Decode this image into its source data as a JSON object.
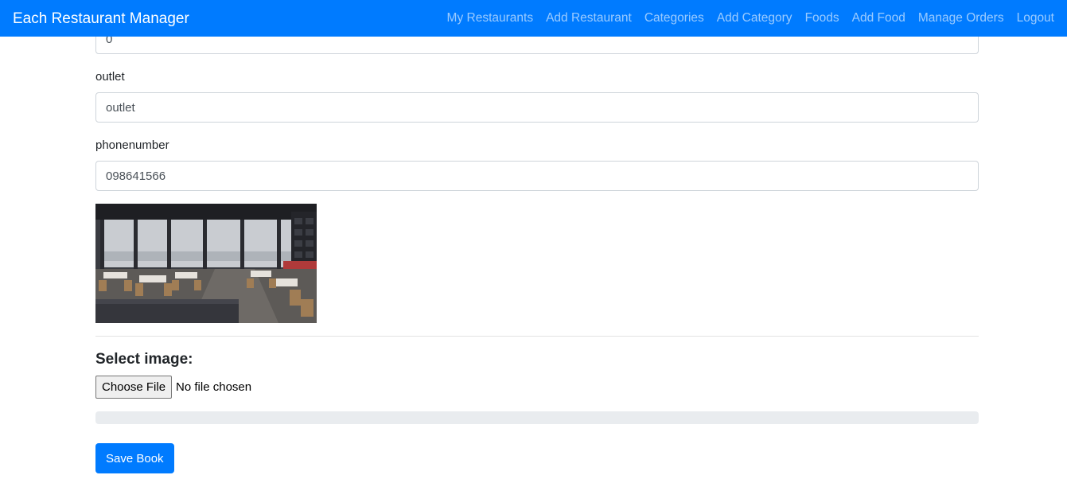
{
  "navbar": {
    "brand": "Each Restaurant Manager",
    "links": [
      {
        "label": "My Restaurants"
      },
      {
        "label": "Add Restaurant"
      },
      {
        "label": "Categories"
      },
      {
        "label": "Add Category"
      },
      {
        "label": "Foods"
      },
      {
        "label": "Add Food"
      },
      {
        "label": "Manage Orders"
      },
      {
        "label": "Logout"
      }
    ]
  },
  "form": {
    "top_field_value": "0",
    "outlet": {
      "label": "outlet",
      "value": "outlet"
    },
    "phonenumber": {
      "label": "phonenumber",
      "value": "098641566"
    },
    "select_image_title": "Select image:",
    "file_button_label": "Choose File",
    "file_status": "No file chosen",
    "upload_progress_percent": 0,
    "save_label": "Save Book"
  },
  "colors": {
    "primary": "#007bff",
    "progress_track": "#e9ecef"
  }
}
